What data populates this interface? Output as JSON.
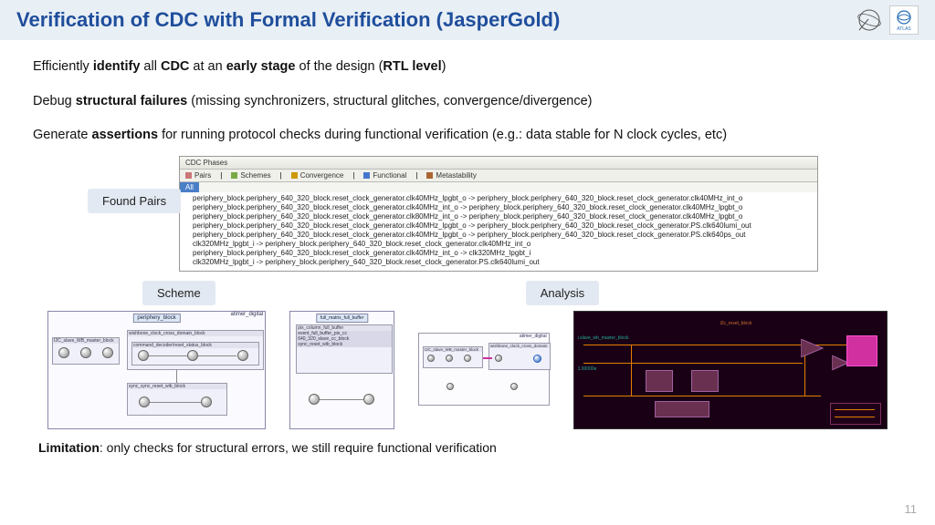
{
  "header": {
    "title": "Verification of CDC with Formal Verification (JasperGold)",
    "logo1": "CERN",
    "logo2": "ATLAS"
  },
  "bullets": {
    "b1_pre": "Efficiently ",
    "b1_bold1": "identify",
    "b1_mid1": " all ",
    "b1_bold2": "CDC",
    "b1_mid2": " at an ",
    "b1_bold3": "early stage",
    "b1_mid3": " of the design (",
    "b1_bold4": "RTL level",
    "b1_end": ")",
    "b2_pre": "Debug ",
    "b2_bold": "structural failures",
    "b2_end": " (missing synchronizers, structural glitches, convergence/divergence)",
    "b3_pre": "Generate ",
    "b3_bold": "assertions",
    "b3_end": " for running protocol checks during functional verification (e.g.: data stable for N clock cycles, etc)"
  },
  "labels": {
    "found": "Found Pairs",
    "scheme": "Scheme",
    "analysis": "Analysis"
  },
  "cdc": {
    "title": "CDC Phases",
    "tabs": {
      "pairs": "Pairs",
      "schemes": "Schemes",
      "conv": "Convergence",
      "func": "Functional",
      "meta": "Metastability"
    },
    "all": "All",
    "lines": [
      "periphery_block.periphery_640_320_block.reset_clock_generator.clk40MHz_lpgbt_o -> periphery_block.periphery_640_320_block.reset_clock_generator.clk40MHz_int_o",
      "periphery_block.periphery_640_320_block.reset_clock_generator.clk40MHz_int_o -> periphery_block.periphery_640_320_block.reset_clock_generator.clk40MHz_lpgbt_o",
      "periphery_block.periphery_640_320_block.reset_clock_generator.clk80MHz_int_o -> periphery_block.periphery_640_320_block.reset_clock_generator.clk40MHz_lpgbt_o",
      "periphery_block.periphery_640_320_block.reset_clock_generator.clk40MHz_lpgbt_o -> periphery_block.periphery_640_320_block.reset_clock_generator.PS.clk640lumi_out",
      "periphery_block.periphery_640_320_block.reset_clock_generator.clk40MHz_lpgbt_o -> periphery_block.periphery_640_320_block.reset_clock_generator.PS.clk640ps_out",
      "clk320MHz_lpgbt_i -> periphery_block.periphery_640_320_block.reset_clock_generator.clk40MHz_int_o",
      "periphery_block.periphery_640_320_block.reset_clock_generator.clk40MHz_int_o -> clk320MHz_lpgbt_i",
      "clk320MHz_lpgbt_i -> periphery_block.periphery_640_320_block.reset_clock_generator.PS.clk640lumi_out"
    ]
  },
  "scheme_labels": {
    "top": "atimer_digital",
    "peri": "periphery_block",
    "full": "full_matrix_full_buffer",
    "wb": "I2C_slave_WB_master_block",
    "wish": "wishbone_clock_cross_domain_block",
    "cmd": "command_decoder/reset_status_block",
    "sync": "sync_sync_reset_wib_block",
    "pix": "pix_column_full_buffer"
  },
  "limitation": {
    "pre": "Limitation",
    "rest": ": only checks for structural errors, we still require functional verification"
  },
  "page": "11"
}
